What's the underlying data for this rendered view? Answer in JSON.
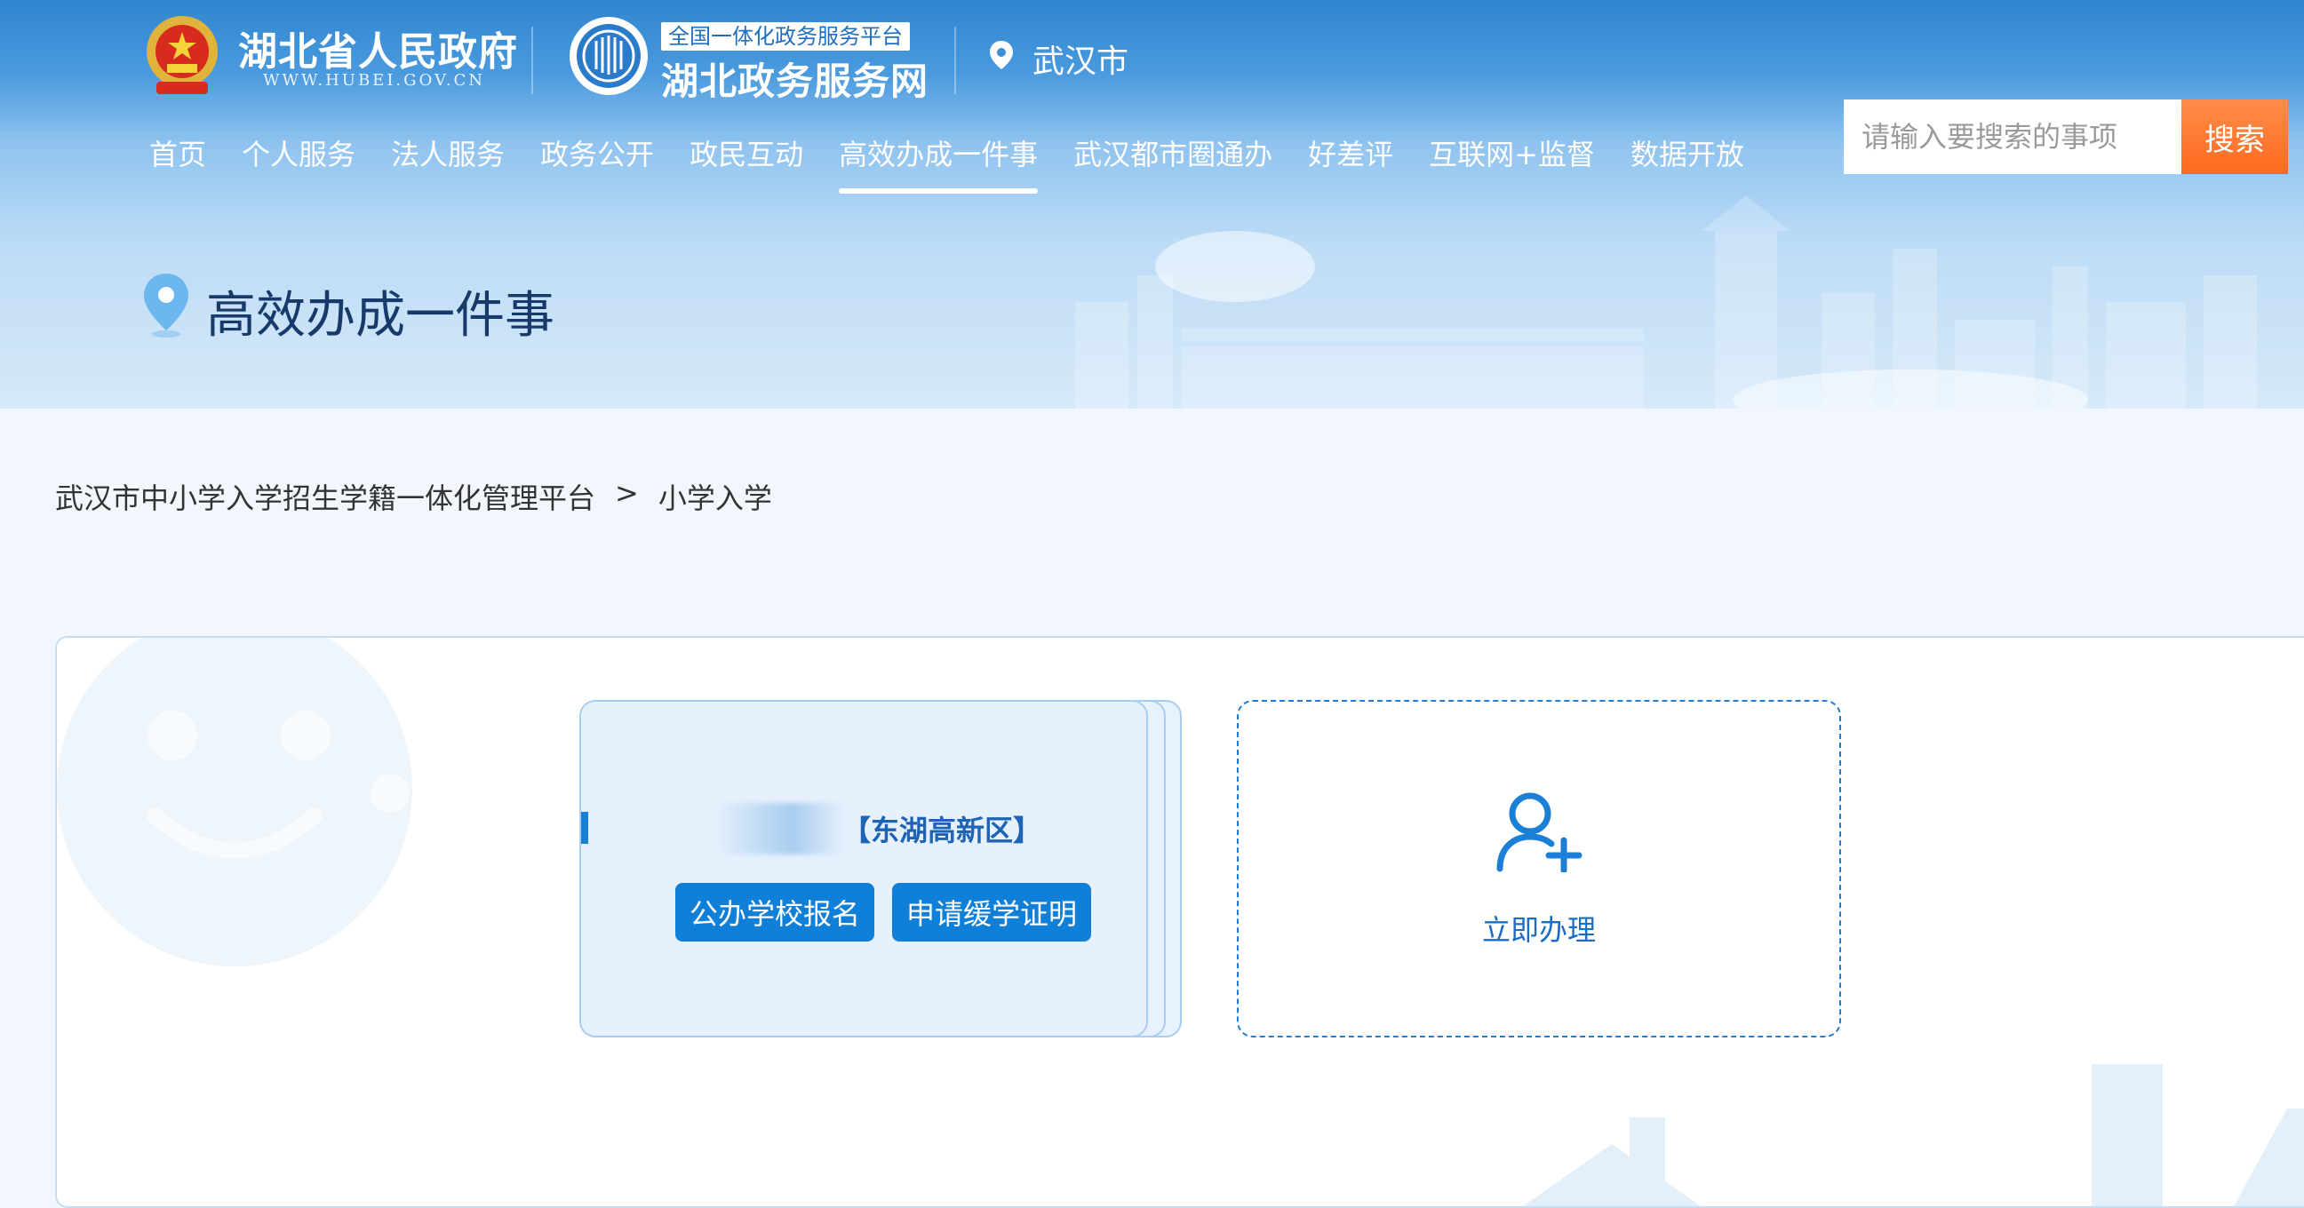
{
  "header": {
    "gov_name": "湖北省人民政府",
    "gov_url": "WWW.HUBEI.GOV.CN",
    "platform_tag": "全国一体化政务服务平台",
    "platform_name": "湖北政务服务网",
    "location": "武汉市"
  },
  "nav": {
    "items": [
      {
        "label": "首页"
      },
      {
        "label": "个人服务"
      },
      {
        "label": "法人服务"
      },
      {
        "label": "政务公开"
      },
      {
        "label": "政民互动"
      },
      {
        "label": "高效办成一件事",
        "active": true
      },
      {
        "label": "武汉都市圈通办"
      },
      {
        "label": "好差评"
      },
      {
        "label": "互联网+监督"
      },
      {
        "label": "数据开放"
      }
    ]
  },
  "search": {
    "placeholder": "请输入要搜索的事项",
    "button_label": "搜索"
  },
  "page": {
    "title": "高效办成一件事"
  },
  "breadcrumb": {
    "parent": "武汉市中小学入学招生学籍一体化管理平台",
    "separator": ">",
    "current": "小学入学"
  },
  "card": {
    "district": "【东湖高新区】",
    "enroll_label": "公办学校报名",
    "defer_label": "申请缓学证明"
  },
  "new_card": {
    "label": "立即办理"
  },
  "colors": {
    "accent": "#0f7fd8",
    "search_button": "#ff6a1f",
    "title": "#173a6b"
  }
}
